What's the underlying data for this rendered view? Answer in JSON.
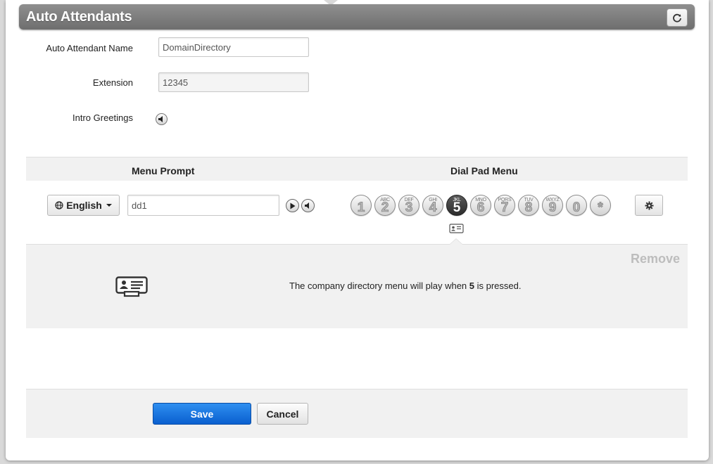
{
  "header": {
    "title": "Auto Attendants",
    "refresh_icon": "refresh-icon"
  },
  "form": {
    "name_label": "Auto Attendant Name",
    "name_value": "DomainDirectory",
    "extension_label": "Extension",
    "extension_value": "12345",
    "intro_label": "Intro Greetings",
    "intro_icon": "speaker-icon"
  },
  "menu": {
    "menu_prompt_heading": "Menu Prompt",
    "dial_pad_heading": "Dial Pad Menu",
    "language": "English",
    "prompt_value": "dd1",
    "keys": [
      {
        "num": "1",
        "letters": ""
      },
      {
        "num": "2",
        "letters": "ABC"
      },
      {
        "num": "3",
        "letters": "DEF"
      },
      {
        "num": "4",
        "letters": "GHI"
      },
      {
        "num": "5",
        "letters": "JKL"
      },
      {
        "num": "6",
        "letters": "MNO"
      },
      {
        "num": "7",
        "letters": "PQRS"
      },
      {
        "num": "8",
        "letters": "TUV"
      },
      {
        "num": "9",
        "letters": "WXYZ"
      },
      {
        "num": "0",
        "letters": ""
      },
      {
        "num": "*",
        "letters": ""
      }
    ],
    "active_key": "5"
  },
  "detail": {
    "remove_label": "Remove",
    "text_before": "The company directory menu will play when ",
    "key": "5",
    "text_after": " is pressed."
  },
  "footer": {
    "save_label": "Save",
    "cancel_label": "Cancel"
  },
  "colors": {
    "primary": "#0a5fcf",
    "header": "#7a7a7a",
    "active_key": "#2c2c2c"
  }
}
